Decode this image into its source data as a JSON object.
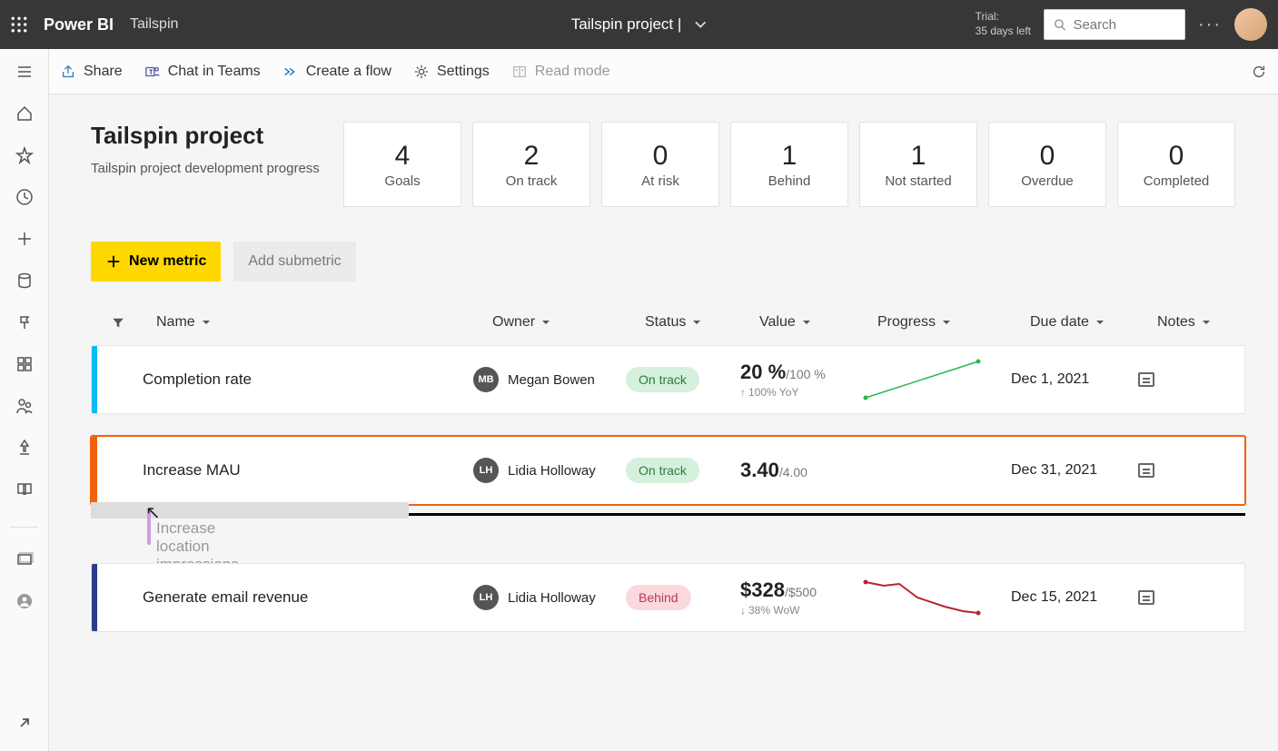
{
  "topbar": {
    "brand": "Power BI",
    "subtitle": "Tailspin",
    "center_title": "Tailspin project  |",
    "trial_line1": "Trial:",
    "trial_line2": "35 days left",
    "search_placeholder": "Search"
  },
  "commands": {
    "share": "Share",
    "chat": "Chat in Teams",
    "flow": "Create a flow",
    "settings": "Settings",
    "read": "Read mode"
  },
  "header": {
    "title": "Tailspin project",
    "subtitle": "Tailspin project development progress"
  },
  "stats": [
    {
      "num": "4",
      "label": "Goals"
    },
    {
      "num": "2",
      "label": "On track"
    },
    {
      "num": "0",
      "label": "At risk"
    },
    {
      "num": "1",
      "label": "Behind"
    },
    {
      "num": "1",
      "label": "Not started"
    },
    {
      "num": "0",
      "label": "Overdue"
    },
    {
      "num": "0",
      "label": "Completed"
    }
  ],
  "buttons": {
    "new_metric": "New metric",
    "add_submetric": "Add submetric"
  },
  "columns": {
    "name": "Name",
    "owner": "Owner",
    "status": "Status",
    "value": "Value",
    "progress": "Progress",
    "due": "Due date",
    "notes": "Notes"
  },
  "rows": [
    {
      "name": "Completion rate",
      "owner_initials": "MB",
      "owner": "Megan Bowen",
      "status": "On track",
      "status_class": "ontrack",
      "value_main": "20 %",
      "value_sub": "/100 %",
      "trend_arrow": "↑",
      "trend": "100% YoY",
      "due": "Dec 1, 2021"
    },
    {
      "name": "Increase MAU",
      "owner_initials": "LH",
      "owner": "Lidia Holloway",
      "status": "On track",
      "status_class": "ontrack",
      "value_main": "3.40",
      "value_sub": "/4.00",
      "trend_arrow": "",
      "trend": "",
      "due": "Dec 31, 2021"
    },
    {
      "name": "Generate email revenue",
      "owner_initials": "LH",
      "owner": "Lidia Holloway",
      "status": "Behind",
      "status_class": "behind",
      "value_main": "$328",
      "value_sub": "/$500",
      "trend_arrow": "↓",
      "trend": "38% WoW",
      "due": "Dec 15, 2021"
    }
  ],
  "drag": {
    "label": "Increase location impressions"
  },
  "chart_data": [
    {
      "type": "line",
      "title": "Completion rate sparkline",
      "values": [
        5,
        20
      ],
      "color": "#2bb84d"
    },
    {
      "type": "line",
      "title": "Generate email revenue sparkline",
      "values": [
        440,
        430,
        390,
        350,
        335,
        328
      ],
      "color": "#b4262c"
    }
  ]
}
